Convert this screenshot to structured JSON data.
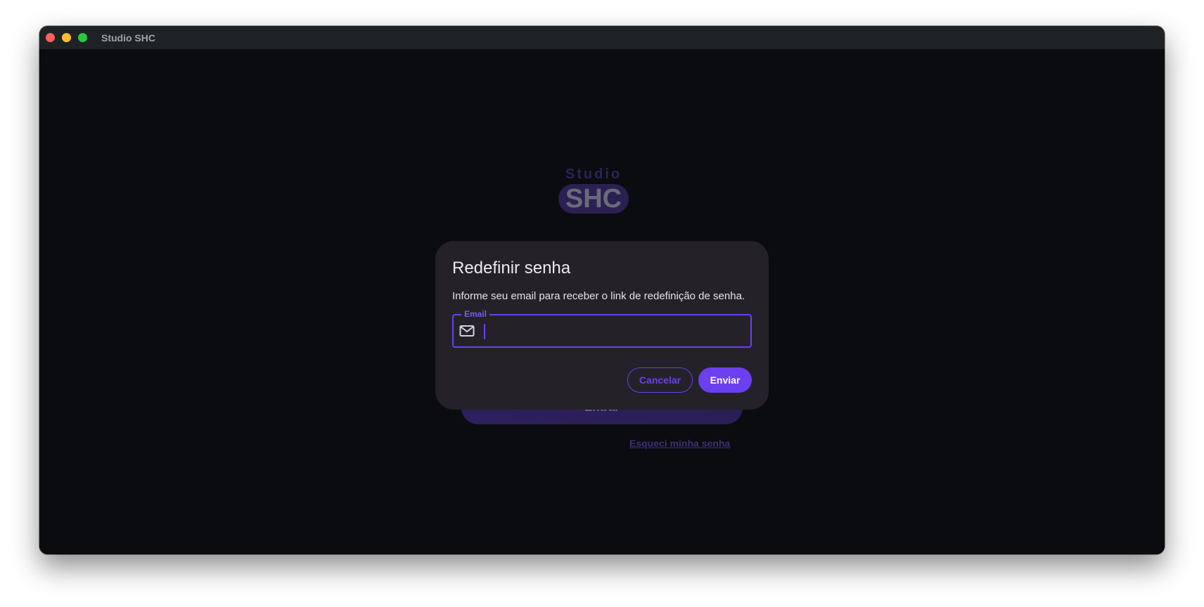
{
  "window": {
    "title": "Studio SHC"
  },
  "background": {
    "logo_studio": "Studio",
    "logo_shc": "SHC",
    "login_button": "Entrar",
    "forgot_link": "Esqueci minha senha"
  },
  "dialog": {
    "title": "Redefinir senha",
    "description": "Informe seu email para receber o link de redefinição de senha.",
    "email_label": "Email",
    "email_value": "",
    "email_icon": "mail-icon",
    "cancel_label": "Cancelar",
    "send_label": "Enviar"
  },
  "colors": {
    "accent": "#6c3ff0",
    "dialog_bg": "#242228",
    "window_bg": "#0b0c0f"
  }
}
